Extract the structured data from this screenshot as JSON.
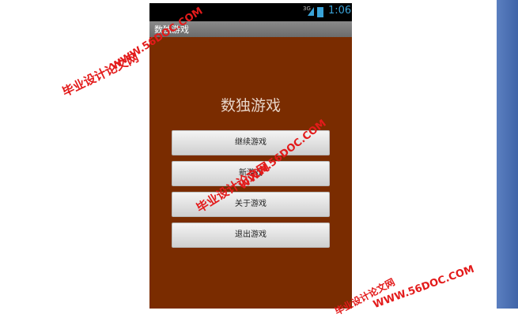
{
  "status_bar": {
    "network": "3G",
    "time": "1:06"
  },
  "app": {
    "title": "数独游戏",
    "heading": "数独游戏"
  },
  "menu": [
    {
      "label": "继续游戏"
    },
    {
      "label": "新游戏"
    },
    {
      "label": "关于游戏"
    },
    {
      "label": "退出游戏"
    }
  ],
  "watermarks": {
    "site_cn": "毕业设计论文网",
    "site_url": "WWW.56DOC.COM"
  },
  "colors": {
    "app_background": "#7a2c00",
    "status_accent": "#3aa3d8",
    "watermark": "#e31b1b"
  }
}
